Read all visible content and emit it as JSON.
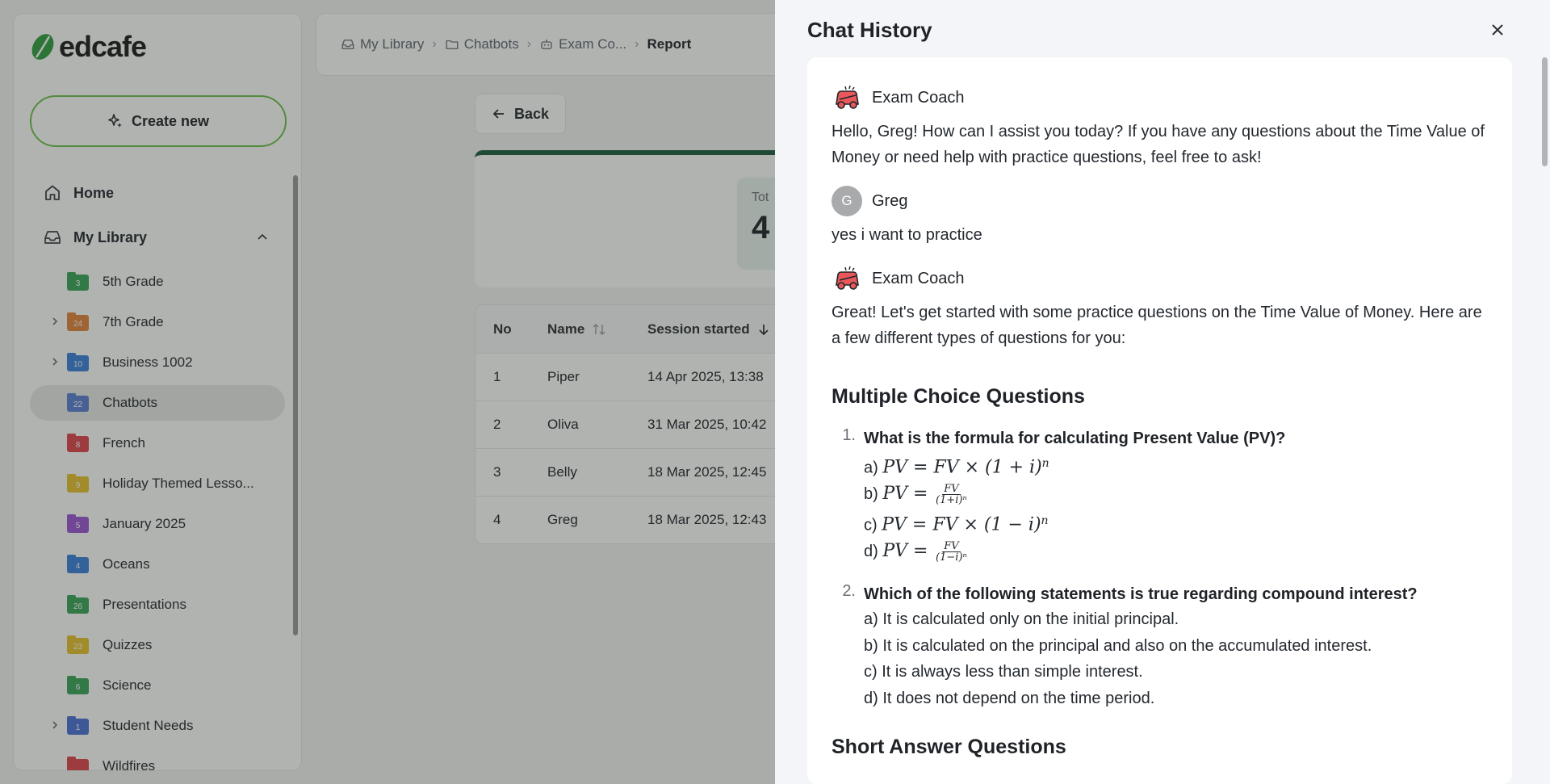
{
  "app": {
    "brand": "edcafe"
  },
  "sidebar": {
    "create_label": "Create new",
    "home_label": "Home",
    "library_label": "My Library",
    "folders": [
      {
        "label": "5th Grade",
        "count": "3",
        "color": "#3aa55a",
        "expandable": false
      },
      {
        "label": "7th Grade",
        "count": "24",
        "color": "#e3843a",
        "expandable": true
      },
      {
        "label": "Business 1002",
        "count": "10",
        "color": "#3b7fd9",
        "expandable": true
      },
      {
        "label": "Chatbots",
        "count": "22",
        "color": "#5b7fd4",
        "expandable": false,
        "active": true
      },
      {
        "label": "French",
        "count": "8",
        "color": "#e0454c",
        "expandable": false
      },
      {
        "label": "Holiday Themed Lesso...",
        "count": "9",
        "color": "#e8c02d",
        "expandable": false
      },
      {
        "label": "January 2025",
        "count": "5",
        "color": "#9b57d3",
        "expandable": false
      },
      {
        "label": "Oceans",
        "count": "4",
        "color": "#3b7fd9",
        "expandable": false
      },
      {
        "label": "Presentations",
        "count": "26",
        "color": "#3aa55a",
        "expandable": false
      },
      {
        "label": "Quizzes",
        "count": "23",
        "color": "#e8c02d",
        "expandable": false
      },
      {
        "label": "Science",
        "count": "6",
        "color": "#3aa55a",
        "expandable": false
      },
      {
        "label": "Student Needs",
        "count": "1",
        "color": "#4b6fd6",
        "expandable": true
      },
      {
        "label": "Wildfires",
        "count": "",
        "color": "#e0454c",
        "expandable": false
      }
    ]
  },
  "breadcrumb": {
    "items": [
      "My Library",
      "Chatbots",
      "Exam Co...",
      "Report"
    ]
  },
  "main": {
    "back_label": "Back",
    "stat_label": "Tot",
    "stat_value": "4",
    "table": {
      "headers": [
        "No",
        "Name",
        "Session started"
      ],
      "rows": [
        {
          "no": "1",
          "name": "Piper",
          "started": "14 Apr 2025, 13:38"
        },
        {
          "no": "2",
          "name": "Oliva",
          "started": "31 Mar 2025, 10:42"
        },
        {
          "no": "3",
          "name": "Belly",
          "started": "18 Mar 2025, 12:45"
        },
        {
          "no": "4",
          "name": "Greg",
          "started": "18 Mar 2025, 12:43"
        }
      ]
    }
  },
  "drawer": {
    "title": "Chat History",
    "messages": [
      {
        "author": "Exam Coach",
        "text": "Hello, Greg! How can I assist you today? If you have any questions about the Time Value of Money or need help with practice questions, feel free to ask!"
      },
      {
        "author": "Greg",
        "avatar_letter": "G",
        "text": "yes i want to practice"
      },
      {
        "author": "Exam Coach",
        "text": "Great! Let's get started with some practice questions on the Time Value of Money. Here are a few different types of questions for you:"
      }
    ],
    "section1": "Multiple Choice Questions",
    "q1": {
      "num": "1.",
      "title": "What is the formula for calculating Present Value (PV)?",
      "a_prefix": "a)",
      "a_math": "PV = FV × (1 + i)",
      "b_prefix": "b)",
      "b_math": "PV =",
      "b_num": "FV",
      "b_den": "(1+i)ⁿ",
      "c_prefix": "c)",
      "c_math": "PV = FV × (1 − i)",
      "d_prefix": "d)",
      "d_math": "PV =",
      "d_num": "FV",
      "d_den": "(1−i)ⁿ",
      "exp": "n"
    },
    "q2": {
      "num": "2.",
      "title": "Which of the following statements is true regarding compound interest?",
      "options": [
        "a) It is calculated only on the initial principal.",
        "b) It is calculated on the principal and also on the accumulated interest.",
        "c) It is always less than simple interest.",
        "d) It does not depend on the time period."
      ]
    },
    "section2": "Short Answer Questions"
  }
}
